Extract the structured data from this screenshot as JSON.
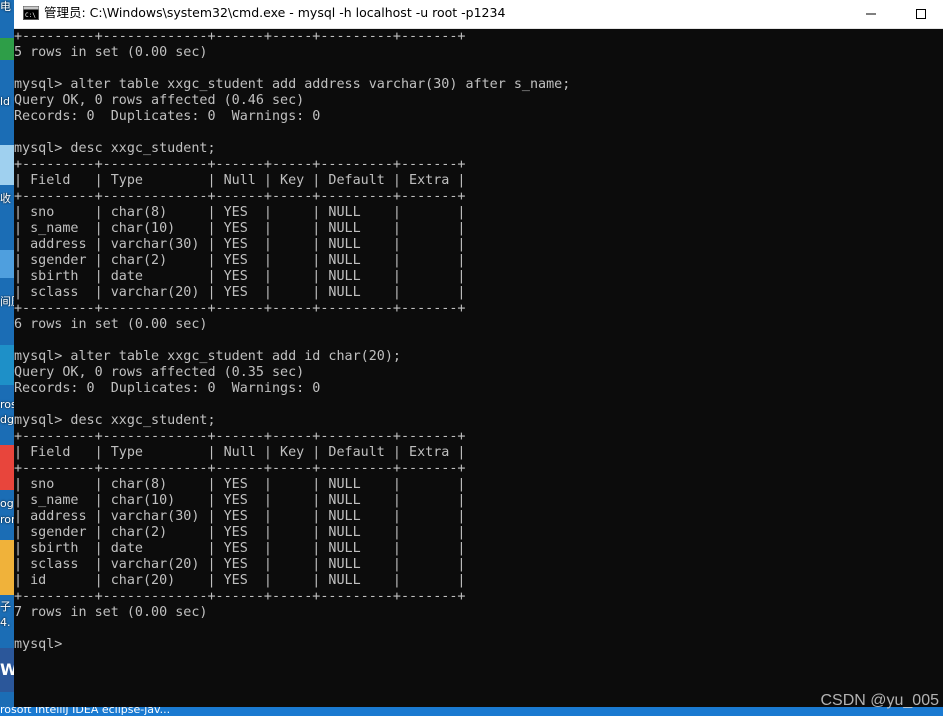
{
  "window": {
    "title": "管理员: C:\\Windows\\system32\\cmd.exe - mysql  -h localhost -u root -p1234",
    "minimize_glyph": "—",
    "maximize_glyph": "☐",
    "icon": "cmd-icon"
  },
  "desktop_labels": [
    "电",
    "ld",
    "收",
    "间压",
    "ros",
    "dg",
    "og",
    "ror",
    "子",
    "4.",
    "W",
    "rosoft"
  ],
  "taskbar": {
    "text": "rosoft    IntelliJ  IDEA  eclipse-jav..."
  },
  "watermark": "CSDN @yu_005",
  "console": {
    "lines": [
      "+---------+-------------+------+-----+---------+-------+",
      "5 rows in set (0.00 sec)",
      "",
      "mysql> alter table xxgc_student add address varchar(30) after s_name;",
      "Query OK, 0 rows affected (0.46 sec)",
      "Records: 0  Duplicates: 0  Warnings: 0",
      "",
      "mysql> desc xxgc_student;",
      "+---------+-------------+------+-----+---------+-------+",
      "| Field   | Type        | Null | Key | Default | Extra |",
      "+---------+-------------+------+-----+---------+-------+",
      "| sno     | char(8)     | YES  |     | NULL    |       |",
      "| s_name  | char(10)    | YES  |     | NULL    |       |",
      "| address | varchar(30) | YES  |     | NULL    |       |",
      "| sgender | char(2)     | YES  |     | NULL    |       |",
      "| sbirth  | date        | YES  |     | NULL    |       |",
      "| sclass  | varchar(20) | YES  |     | NULL    |       |",
      "+---------+-------------+------+-----+---------+-------+",
      "6 rows in set (0.00 sec)",
      "",
      "mysql> alter table xxgc_student add id char(20);",
      "Query OK, 0 rows affected (0.35 sec)",
      "Records: 0  Duplicates: 0  Warnings: 0",
      "",
      "mysql> desc xxgc_student;",
      "+---------+-------------+------+-----+---------+-------+",
      "| Field   | Type        | Null | Key | Default | Extra |",
      "+---------+-------------+------+-----+---------+-------+",
      "| sno     | char(8)     | YES  |     | NULL    |       |",
      "| s_name  | char(10)    | YES  |     | NULL    |       |",
      "| address | varchar(30) | YES  |     | NULL    |       |",
      "| sgender | char(2)     | YES  |     | NULL    |       |",
      "| sbirth  | date        | YES  |     | NULL    |       |",
      "| sclass  | varchar(20) | YES  |     | NULL    |       |",
      "| id      | char(20)    | YES  |     | NULL    |       |",
      "+---------+-------------+------+-----+---------+-------+",
      "7 rows in set (0.00 sec)",
      "",
      "mysql> "
    ]
  },
  "colors": {
    "console_bg": "#0c0c0c",
    "console_text": "#c0c0c0",
    "titlebar_bg": "#ffffff",
    "desktop_blue": "#1b6db5"
  }
}
